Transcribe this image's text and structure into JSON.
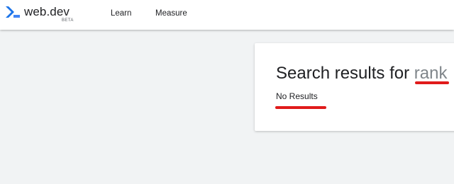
{
  "header": {
    "brand": "web.dev",
    "badge": "BETA",
    "nav": [
      {
        "label": "Learn"
      },
      {
        "label": "Measure"
      }
    ]
  },
  "search": {
    "title_prefix": "Search results for ",
    "query": "rank",
    "result_text": "No Results"
  },
  "colors": {
    "logo_blue": "#1a73e8",
    "logo_blue_light": "#4285f4",
    "query_gray": "#80868b",
    "highlight_red": "#e01b1b",
    "background": "#f1f3f4"
  },
  "icons": {
    "logo": "web-dev-chevron-logo-icon"
  }
}
